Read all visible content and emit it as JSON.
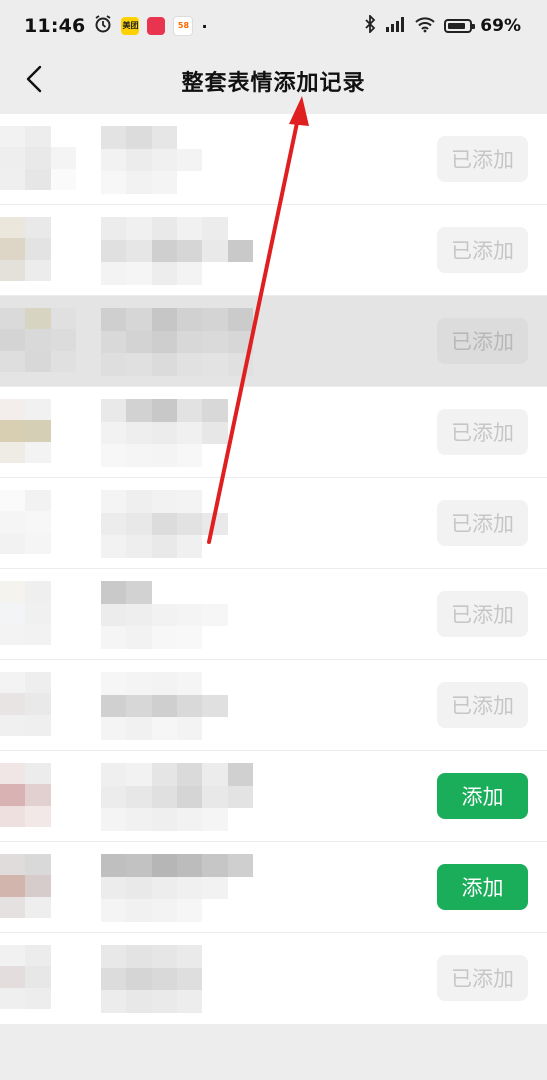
{
  "status_bar": {
    "time": "11:46",
    "app_icons": [
      "美团",
      "",
      "58"
    ],
    "dot": "·",
    "battery": "69%",
    "battery_level": 0.69
  },
  "nav": {
    "title": "整套表情添加记录",
    "back_icon": "chevron-left-icon"
  },
  "list": {
    "rows": [
      {
        "action": "已添加",
        "state": "added"
      },
      {
        "action": "已添加",
        "state": "added"
      },
      {
        "action": "已添加",
        "state": "added",
        "highlighted": true
      },
      {
        "action": "已添加",
        "state": "added"
      },
      {
        "action": "已添加",
        "state": "added"
      },
      {
        "action": "已添加",
        "state": "added"
      },
      {
        "action": "已添加",
        "state": "added"
      },
      {
        "action": "添加",
        "state": "add"
      },
      {
        "action": "添加",
        "state": "add"
      },
      {
        "action": "已添加",
        "state": "added"
      }
    ]
  },
  "colors": {
    "accent_green": "#1aad5a",
    "annotation_arrow": "#e02020"
  }
}
